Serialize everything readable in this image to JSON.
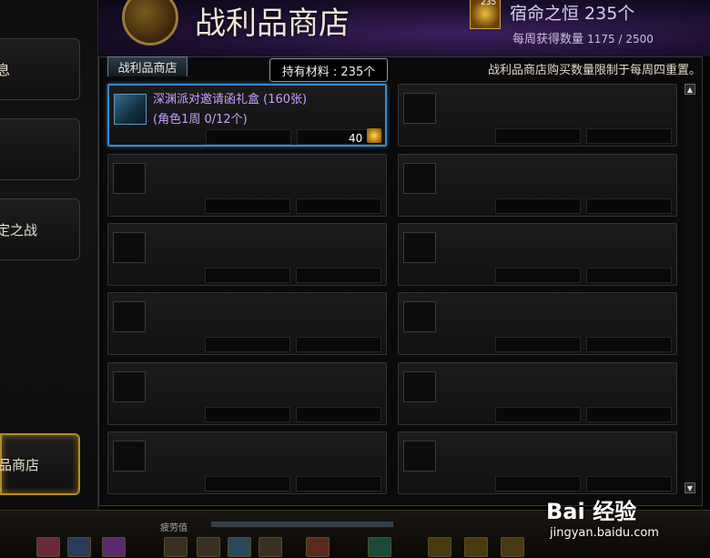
{
  "sidebar": {
    "items": [
      {
        "label": "息",
        "active": false
      },
      {
        "label": "",
        "active": false
      },
      {
        "label": "定之战",
        "active": false
      },
      {
        "label": "品商店",
        "active": true
      }
    ]
  },
  "header": {
    "title": "战利品商店",
    "currency_badge": "235",
    "currency_text": "宿命之恒 235个",
    "weekly_label": "每周获得数量",
    "weekly_value": "1175 / 2500"
  },
  "tab": {
    "label": "战利品商店"
  },
  "tooltip": "持有材料 : 235个",
  "notice": "战利品商店购买数量限制于每周四重置。",
  "shop_items": [
    {
      "name": "深渊派对邀请函礼盒 (160张)",
      "sub": "(角色1周 0/12个)",
      "price": "40",
      "selected": true
    }
  ],
  "hud": {
    "label": "疲劳值"
  },
  "watermark": {
    "brand": "Bai 经验",
    "url": "jingyan.baidu.com"
  },
  "colors": {
    "accent_gold": "#b78a2a",
    "selected_blue": "#3a8ac8",
    "item_text": "#c8a0ff"
  }
}
